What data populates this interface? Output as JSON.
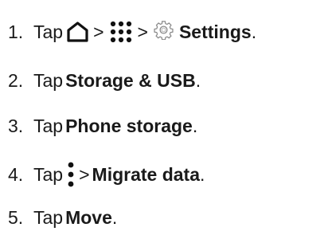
{
  "steps": [
    {
      "number": "1.",
      "tap": "Tap",
      "sep1": ">",
      "sep2": ">",
      "target": "Settings",
      "suffix": ".",
      "icons": [
        "home-icon",
        "apps-grid-icon",
        "gear-icon"
      ]
    },
    {
      "number": "2.",
      "tap": "Tap",
      "target": "Storage & USB",
      "suffix": "."
    },
    {
      "number": "3.",
      "tap": "Tap",
      "target": "Phone storage",
      "suffix": "."
    },
    {
      "number": "4.",
      "tap": "Tap",
      "sep": ">",
      "target": "Migrate data",
      "suffix": ".",
      "icons": [
        "menu-more-icon"
      ]
    },
    {
      "number": "5.",
      "tap": "Tap",
      "target": "Move",
      "suffix": "."
    }
  ]
}
